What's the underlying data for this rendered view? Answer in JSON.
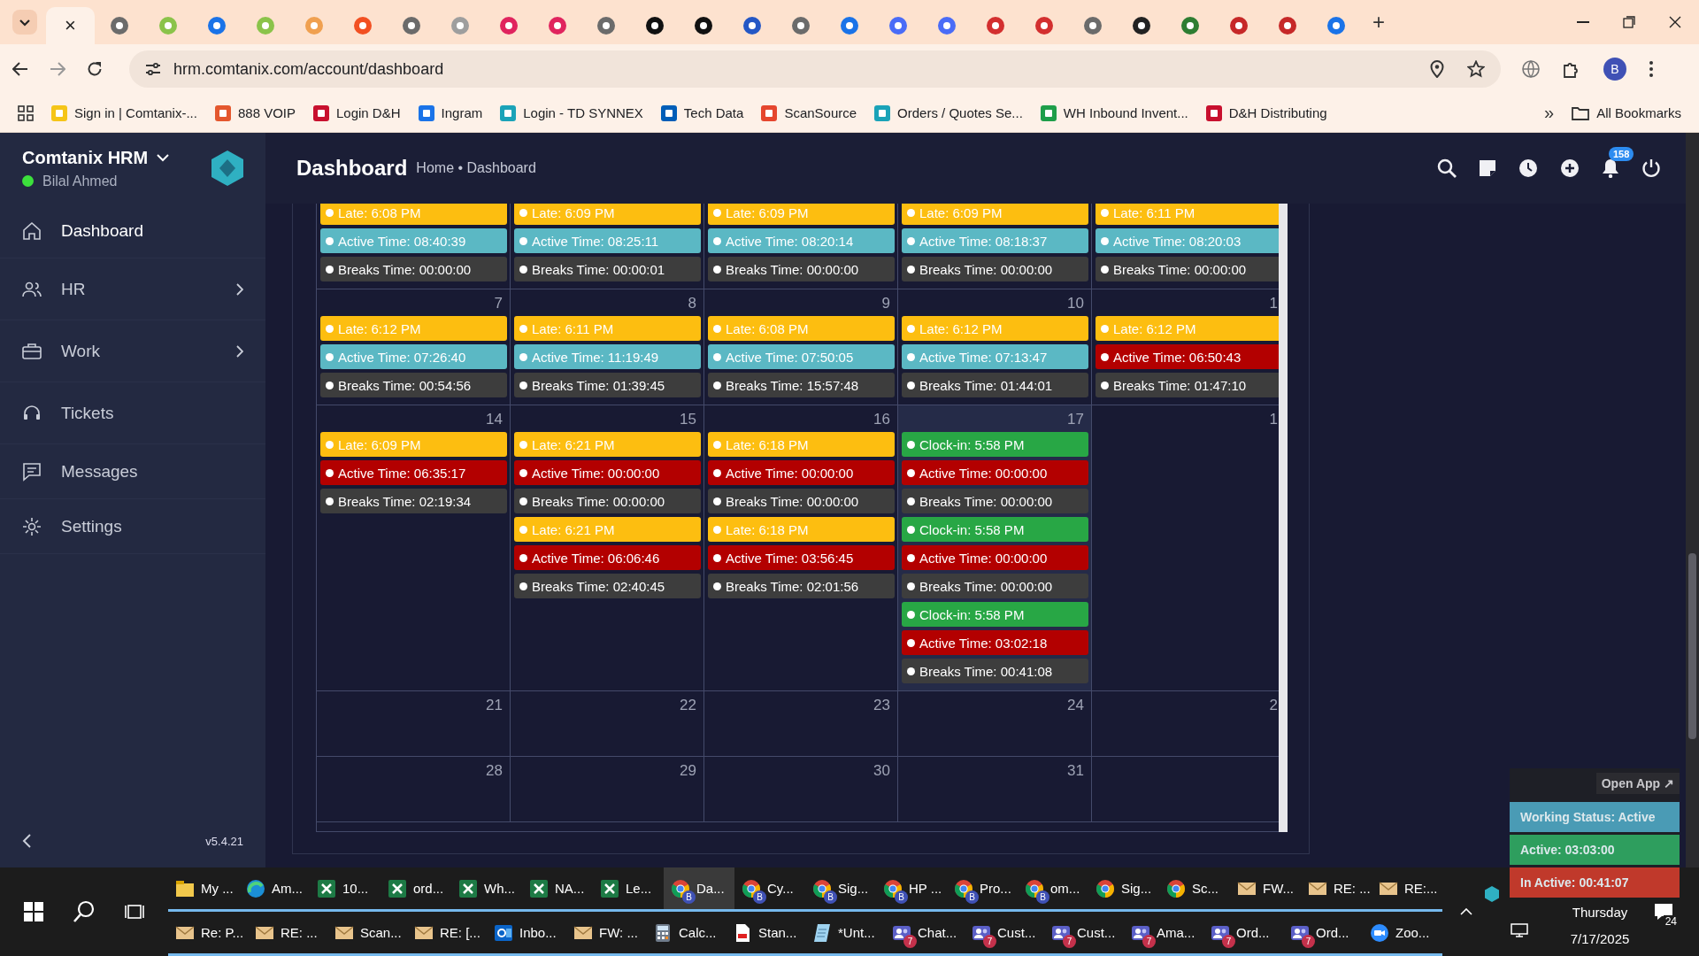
{
  "browser": {
    "tabs": [
      {
        "selected": true,
        "close": "×"
      },
      {
        "selected": false,
        "color": "#6b6b6b"
      },
      {
        "selected": false,
        "color": "#8bc34a"
      },
      {
        "selected": false,
        "color": "#1a73e8"
      },
      {
        "selected": false,
        "color": "#8bc34a"
      },
      {
        "selected": false,
        "color": "#f0a050"
      },
      {
        "selected": false,
        "color": "#f25022"
      },
      {
        "selected": false,
        "color": "#6b6b6b"
      },
      {
        "selected": false,
        "color": "#9e9e9e"
      },
      {
        "selected": false,
        "color": "#e0245e"
      },
      {
        "selected": false,
        "color": "#e0245e"
      },
      {
        "selected": false,
        "color": "#6b6b6b"
      },
      {
        "selected": false,
        "color": "#111111"
      },
      {
        "selected": false,
        "color": "#111111"
      },
      {
        "selected": false,
        "color": "#2457c5"
      },
      {
        "selected": false,
        "color": "#6b6b6b"
      },
      {
        "selected": false,
        "color": "#1a73e8"
      },
      {
        "selected": false,
        "color": "#4a6cf7"
      },
      {
        "selected": false,
        "color": "#4a6cf7"
      },
      {
        "selected": false,
        "color": "#d32f2f"
      },
      {
        "selected": false,
        "color": "#d32f2f"
      },
      {
        "selected": false,
        "color": "#6b6b6b"
      },
      {
        "selected": false,
        "color": "#222222"
      },
      {
        "selected": false,
        "color": "#2e7d32"
      },
      {
        "selected": false,
        "color": "#c62828"
      },
      {
        "selected": false,
        "color": "#c62828"
      },
      {
        "selected": false,
        "color": "#1a73e8"
      }
    ],
    "new_tab": "+",
    "url": "hrm.comtanix.com/account/dashboard",
    "profile": "B",
    "bookmarks": [
      {
        "label": "Sign in | Comtanix-...",
        "color": "#f5c518"
      },
      {
        "label": "888 VOIP",
        "color": "#e4572e"
      },
      {
        "label": "Login D&H",
        "color": "#c8102e"
      },
      {
        "label": "Ingram",
        "color": "#1a73e8"
      },
      {
        "label": "Login - TD SYNNEX",
        "color": "#1aa3b8"
      },
      {
        "label": "Tech Data",
        "color": "#005eb8"
      },
      {
        "label": "ScanSource",
        "color": "#e5462e"
      },
      {
        "label": "Orders / Quotes Se...",
        "color": "#1aa3b8"
      },
      {
        "label": "WH Inbound Invent...",
        "color": "#1e9e4a"
      },
      {
        "label": "D&H Distributing",
        "color": "#c8102e"
      }
    ],
    "more_bookmarks": "»",
    "all_bookmarks": "All Bookmarks"
  },
  "sidebar": {
    "title": "Comtanix HRM",
    "user": "Bilal Ahmed",
    "online": true,
    "items": [
      {
        "label": "Dashboard",
        "selected": true,
        "submenu": false
      },
      {
        "label": "HR",
        "selected": false,
        "submenu": true
      },
      {
        "label": "Work",
        "selected": false,
        "submenu": true
      },
      {
        "label": "Tickets",
        "selected": false,
        "submenu": false
      },
      {
        "label": "Messages",
        "selected": false,
        "submenu": false
      },
      {
        "label": "Settings",
        "selected": false,
        "submenu": false
      }
    ],
    "version": "v5.4.21"
  },
  "header": {
    "title": "Dashboard",
    "breadcrumb": "Home • Dashboard",
    "notification_count": "158"
  },
  "calendar": {
    "weeks": [
      {
        "days": [
          {
            "today": false,
            "events": [
              {
                "text": "Late: 6:08 PM",
                "color": "#fdbe10"
              },
              {
                "text": "Active Time: 08:40:39",
                "color": "#5bb8c4"
              },
              {
                "text": "Breaks Time: 00:00:00",
                "color": "#3d3d3d"
              }
            ]
          },
          {
            "today": false,
            "events": [
              {
                "text": "Late: 6:09 PM",
                "color": "#fdbe10"
              },
              {
                "text": "Active Time: 08:25:11",
                "color": "#5bb8c4"
              },
              {
                "text": "Breaks Time: 00:00:01",
                "color": "#3d3d3d"
              }
            ]
          },
          {
            "today": false,
            "events": [
              {
                "text": "Late: 6:09 PM",
                "color": "#fdbe10"
              },
              {
                "text": "Active Time: 08:20:14",
                "color": "#5bb8c4"
              },
              {
                "text": "Breaks Time: 00:00:00",
                "color": "#3d3d3d"
              }
            ]
          },
          {
            "today": false,
            "events": [
              {
                "text": "Late: 6:09 PM",
                "color": "#fdbe10"
              },
              {
                "text": "Active Time: 08:18:37",
                "color": "#5bb8c4"
              },
              {
                "text": "Breaks Time: 00:00:00",
                "color": "#3d3d3d"
              }
            ]
          },
          {
            "today": false,
            "events": [
              {
                "text": "Late: 6:11 PM",
                "color": "#fdbe10"
              },
              {
                "text": "Active Time: 08:20:03",
                "color": "#5bb8c4"
              },
              {
                "text": "Breaks Time: 00:00:00",
                "color": "#3d3d3d"
              }
            ]
          }
        ]
      },
      {
        "days": [
          {
            "day": "7",
            "today": false,
            "events": [
              {
                "text": "Late: 6:12 PM",
                "color": "#fdbe10"
              },
              {
                "text": "Active Time: 07:26:40",
                "color": "#5bb8c4"
              },
              {
                "text": "Breaks Time: 00:54:56",
                "color": "#3d3d3d"
              }
            ]
          },
          {
            "day": "8",
            "today": false,
            "events": [
              {
                "text": "Late: 6:11 PM",
                "color": "#fdbe10"
              },
              {
                "text": "Active Time: 11:19:49",
                "color": "#5bb8c4"
              },
              {
                "text": "Breaks Time: 01:39:45",
                "color": "#3d3d3d"
              }
            ]
          },
          {
            "day": "9",
            "today": false,
            "events": [
              {
                "text": "Late: 6:08 PM",
                "color": "#fdbe10"
              },
              {
                "text": "Active Time: 07:50:05",
                "color": "#5bb8c4"
              },
              {
                "text": "Breaks Time: 15:57:48",
                "color": "#3d3d3d"
              }
            ]
          },
          {
            "day": "10",
            "today": false,
            "events": [
              {
                "text": "Late: 6:12 PM",
                "color": "#fdbe10"
              },
              {
                "text": "Active Time: 07:13:47",
                "color": "#5bb8c4"
              },
              {
                "text": "Breaks Time: 01:44:01",
                "color": "#3d3d3d"
              }
            ]
          },
          {
            "day": "1",
            "today": false,
            "events": [
              {
                "text": "Late: 6:12 PM",
                "color": "#fdbe10"
              },
              {
                "text": "Active Time: 06:50:43",
                "color": "#b30000"
              },
              {
                "text": "Breaks Time: 01:47:10",
                "color": "#3d3d3d"
              }
            ]
          }
        ]
      },
      {
        "days": [
          {
            "day": "14",
            "today": false,
            "events": [
              {
                "text": "Late: 6:09 PM",
                "color": "#fdbe10"
              },
              {
                "text": "Active Time: 06:35:17",
                "color": "#b30000"
              },
              {
                "text": "Breaks Time: 02:19:34",
                "color": "#3d3d3d"
              }
            ]
          },
          {
            "day": "15",
            "today": false,
            "events": [
              {
                "text": "Late: 6:21 PM",
                "color": "#fdbe10"
              },
              {
                "text": "Active Time: 00:00:00",
                "color": "#b30000"
              },
              {
                "text": "Breaks Time: 00:00:00",
                "color": "#3d3d3d"
              },
              {
                "text": "Late: 6:21 PM",
                "color": "#fdbe10"
              },
              {
                "text": "Active Time: 06:06:46",
                "color": "#b30000"
              },
              {
                "text": "Breaks Time: 02:40:45",
                "color": "#3d3d3d"
              }
            ]
          },
          {
            "day": "16",
            "today": false,
            "events": [
              {
                "text": "Late: 6:18 PM",
                "color": "#fdbe10"
              },
              {
                "text": "Active Time: 00:00:00",
                "color": "#b30000"
              },
              {
                "text": "Breaks Time: 00:00:00",
                "color": "#3d3d3d"
              },
              {
                "text": "Late: 6:18 PM",
                "color": "#fdbe10"
              },
              {
                "text": "Active Time: 03:56:45",
                "color": "#b30000"
              },
              {
                "text": "Breaks Time: 02:01:56",
                "color": "#3d3d3d"
              }
            ]
          },
          {
            "day": "17",
            "today": true,
            "events": [
              {
                "text": "Clock-in: 5:58 PM",
                "color": "#28a745"
              },
              {
                "text": "Active Time: 00:00:00",
                "color": "#b30000"
              },
              {
                "text": "Breaks Time: 00:00:00",
                "color": "#3d3d3d"
              },
              {
                "text": "Clock-in: 5:58 PM",
                "color": "#28a745"
              },
              {
                "text": "Active Time: 00:00:00",
                "color": "#b30000"
              },
              {
                "text": "Breaks Time: 00:00:00",
                "color": "#3d3d3d"
              },
              {
                "text": "Clock-in: 5:58 PM",
                "color": "#28a745"
              },
              {
                "text": "Active Time: 03:02:18",
                "color": "#b30000"
              },
              {
                "text": "Breaks Time: 00:41:08",
                "color": "#3d3d3d"
              }
            ]
          },
          {
            "day": "1",
            "today": false
          }
        ]
      },
      {
        "days": [
          {
            "day": "21",
            "today": false
          },
          {
            "day": "22",
            "today": false
          },
          {
            "day": "23",
            "today": false
          },
          {
            "day": "24",
            "today": false
          },
          {
            "day": "2",
            "today": false
          }
        ]
      },
      {
        "days": [
          {
            "day": "28",
            "today": false
          },
          {
            "day": "29",
            "today": false
          },
          {
            "day": "30",
            "today": false
          },
          {
            "day": "31",
            "today": false
          }
        ]
      }
    ]
  },
  "widget": {
    "open_app": "Open App ↗",
    "items": [
      {
        "text": "Working Status: Active",
        "color": "#4a9bb5"
      },
      {
        "text": "Active: 03:03:00",
        "color": "#2e9e5e"
      },
      {
        "text": "In Active: 00:41:07",
        "color": "#c0392b"
      }
    ]
  },
  "taskbar": {
    "upper_windows": [
      {
        "label": "My ...",
        "kind": "folder",
        "selected": false
      },
      {
        "label": "Am...",
        "kind": "edge",
        "selected": false
      },
      {
        "label": "10...",
        "kind": "excel",
        "selected": false
      },
      {
        "label": "ord...",
        "kind": "excel",
        "selected": false
      },
      {
        "label": "Wh...",
        "kind": "excel",
        "selected": false
      },
      {
        "label": "NA...",
        "kind": "excel",
        "selected": false
      },
      {
        "label": "Le...",
        "kind": "excel",
        "selected": false
      },
      {
        "label": "Da...",
        "kind": "chrome",
        "badge": "B",
        "selected": true
      },
      {
        "label": "Cy...",
        "kind": "chrome",
        "badge": "B",
        "selected": false
      },
      {
        "label": "Sig...",
        "kind": "chrome",
        "badge": "B",
        "selected": false
      },
      {
        "label": "HP ...",
        "kind": "chrome",
        "badge": "B",
        "selected": false
      },
      {
        "label": "Pro...",
        "kind": "chrome",
        "badge": "B",
        "selected": false
      },
      {
        "label": "om...",
        "kind": "chrome",
        "badge": "B",
        "selected": false
      },
      {
        "label": "Sig...",
        "kind": "chrome",
        "selected": false
      },
      {
        "label": "Sc...",
        "kind": "chrome",
        "selected": false
      },
      {
        "label": "FW...",
        "kind": "mail",
        "selected": false
      },
      {
        "label": "RE: ...",
        "kind": "mail",
        "selected": false
      },
      {
        "label": "RE:...",
        "kind": "mail",
        "selected": false
      }
    ],
    "lower_windows": [
      {
        "label": "Re: P...",
        "kind": "mail",
        "selected": false
      },
      {
        "label": "RE: ...",
        "kind": "mail",
        "selected": false
      },
      {
        "label": "Scan...",
        "kind": "mail",
        "selected": false
      },
      {
        "label": "RE: [...",
        "kind": "mail",
        "selected": false
      },
      {
        "label": "Inbo...",
        "kind": "outlook",
        "selected": false
      },
      {
        "label": "FW: ...",
        "kind": "mail",
        "selected": false
      },
      {
        "label": "Calc...",
        "kind": "calc",
        "selected": false
      },
      {
        "label": "Stan...",
        "kind": "pdf",
        "selected": false
      },
      {
        "label": "*Unt...",
        "kind": "notepad",
        "selected": false
      },
      {
        "label": "Chat...",
        "kind": "teams",
        "badge": "7",
        "selected": false
      },
      {
        "label": "Cust...",
        "kind": "teams",
        "badge": "7",
        "selected": false
      },
      {
        "label": "Cust...",
        "kind": "teams",
        "badge": "7",
        "selected": false
      },
      {
        "label": "Ama...",
        "kind": "teams",
        "badge": "7",
        "selected": false
      },
      {
        "label": "Ord...",
        "kind": "teams",
        "badge": "7",
        "selected": false
      },
      {
        "label": "Ord...",
        "kind": "teams",
        "badge": "7",
        "selected": false
      },
      {
        "label": "Zoo...",
        "kind": "zoom",
        "selected": false
      }
    ],
    "day": "Thursday",
    "date": "7/17/2025",
    "notifications": "24"
  }
}
